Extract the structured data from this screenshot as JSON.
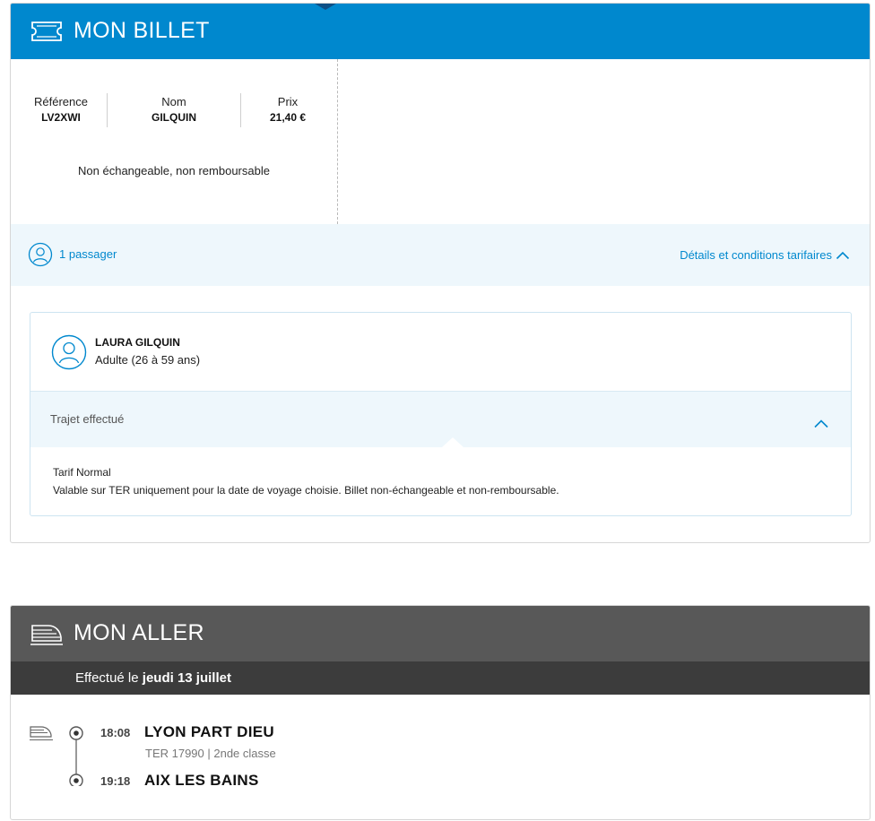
{
  "billet": {
    "title": "MON BILLET",
    "reference_label": "Référence",
    "reference_value": "LV2XWI",
    "nom_label": "Nom",
    "nom_value": "GILQUIN",
    "prix_label": "Prix",
    "prix_value": "21,40 €",
    "conditions": "Non échangeable, non remboursable",
    "passengers": "1 passager",
    "details_link": "Détails et conditions tarifaires",
    "passenger": {
      "name": "LAURA GILQUIN",
      "type": "Adulte (26 à 59 ans)",
      "trajet_label": "Trajet effectué",
      "tarif_title": "Tarif Normal",
      "tarif_desc": "Valable sur TER uniquement pour la date de voyage choisie. Billet non-échangeable et non-remboursable."
    }
  },
  "aller": {
    "title": "MON ALLER",
    "effectue_prefix": "Effectué le",
    "effectue_date": "jeudi 13 juillet",
    "departure": {
      "time": "18:08",
      "station": "LYON PART DIEU"
    },
    "train_info": "TER 17990 | 2nde classe",
    "arrival": {
      "time": "19:18",
      "station": "AIX LES BAINS"
    }
  },
  "colors": {
    "primary_blue": "#0088ce",
    "light_blue_bg": "#eef7fc",
    "dark_header": "#585858",
    "darker_subheader": "#3c3c3c"
  },
  "icons": [
    "ticket-icon",
    "user-icon",
    "chevron-up-icon",
    "train-icon",
    "timeline-stop-icon"
  ]
}
